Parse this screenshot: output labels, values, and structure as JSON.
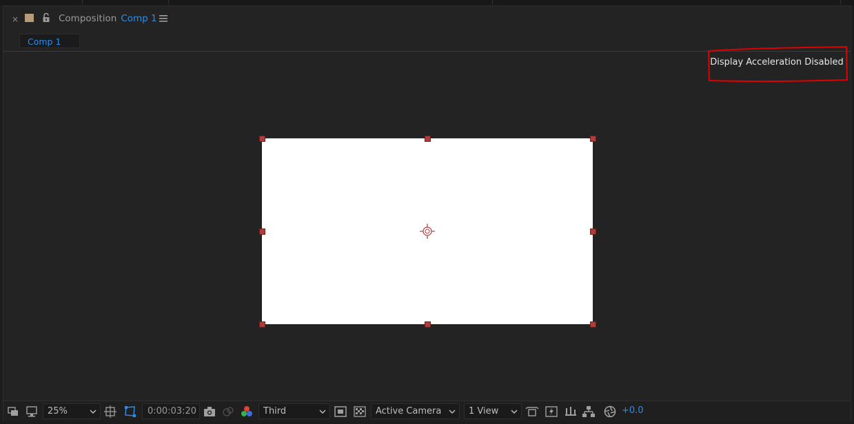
{
  "panel": {
    "close_glyph": "×",
    "title_label": "Composition",
    "comp_name": "Comp 1",
    "tab_label": "Comp 1",
    "swatch_color": "#b59d7c",
    "accent_color": "#2d8ceb",
    "icons": {
      "close": "close-icon",
      "lock": "lock-icon",
      "menu": "hamburger-menu-icon"
    }
  },
  "viewer": {
    "notice": "Display Acceleration Disabled",
    "annotation_color": "#e00000",
    "frame_color": "#ffffff",
    "handle_color": "#b03d3a"
  },
  "toolbar": {
    "magnification": "25%",
    "timecode": "0:00:03:20",
    "resolution": "Third",
    "camera_view": "Active Camera",
    "view_layout": "1 View",
    "exposure": "+0.0",
    "icons": [
      "always-preview-icon",
      "monitor-icon",
      "grid-guides-icon",
      "mask-path-visibility-icon",
      "snapshot-camera-icon",
      "show-snapshot-icon",
      "color-channels-icon",
      "region-of-interest-icon",
      "transparency-grid-icon",
      "toggle-pixel-aspect-icon",
      "fast-previews-icon",
      "timeline-icon",
      "flowchart-icon",
      "reset-exposure-icon"
    ]
  }
}
